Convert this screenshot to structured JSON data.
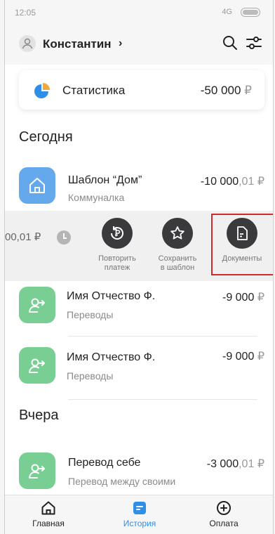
{
  "status": {
    "time": "12:05",
    "network": "4G"
  },
  "header": {
    "user_name": "Константин",
    "chevron": "›"
  },
  "stats": {
    "label": "Статистика",
    "amount": "-50 000",
    "currency": "₽"
  },
  "sections": {
    "today": "Сегодня",
    "yesterday": "Вчера"
  },
  "transactions": [
    {
      "title": "Шаблон “Дом”",
      "subtitle": "Коммуналка",
      "amount_main": "-10 000",
      "amount_cents": ",01",
      "currency": "₽",
      "icon": "home-icon",
      "color": "#63a9ec"
    },
    {
      "title": "Имя Отчество Ф.",
      "subtitle": "Переводы",
      "amount_main": "-9 000",
      "currency": "₽",
      "icon": "person-transfer-icon",
      "color": "#79cf93"
    },
    {
      "title": "Имя Отчество Ф.",
      "subtitle": "Переводы",
      "amount_main": "-9 000",
      "currency": "₽",
      "icon": "person-transfer-icon",
      "color": "#79cf93"
    },
    {
      "title": "Перевод себе",
      "subtitle": "Перевод между своими",
      "amount_main": "-3 000",
      "amount_cents": ",01",
      "currency": "₽",
      "icon": "person-transfer-icon",
      "color": "#79cf93"
    }
  ],
  "swipe": {
    "partial_amount": "00,01 ₽",
    "actions": [
      {
        "label_line1": "Повторить",
        "label_line2": "платеж",
        "icon": "repeat-payment-icon"
      },
      {
        "label_line1": "Сохранить",
        "label_line2": "в шаблон",
        "icon": "star-icon"
      },
      {
        "label_line1": "Документы",
        "label_line2": "",
        "icon": "document-icon"
      }
    ]
  },
  "tabs": [
    {
      "label": "Главная",
      "icon": "home-icon"
    },
    {
      "label": "История",
      "icon": "history-icon",
      "active": true
    },
    {
      "label": "Оплата",
      "icon": "plus-circle-icon"
    }
  ],
  "colors": {
    "accent": "#2f8ee8",
    "highlight": "#d12a2a",
    "action_circle": "#3a3a3c"
  }
}
